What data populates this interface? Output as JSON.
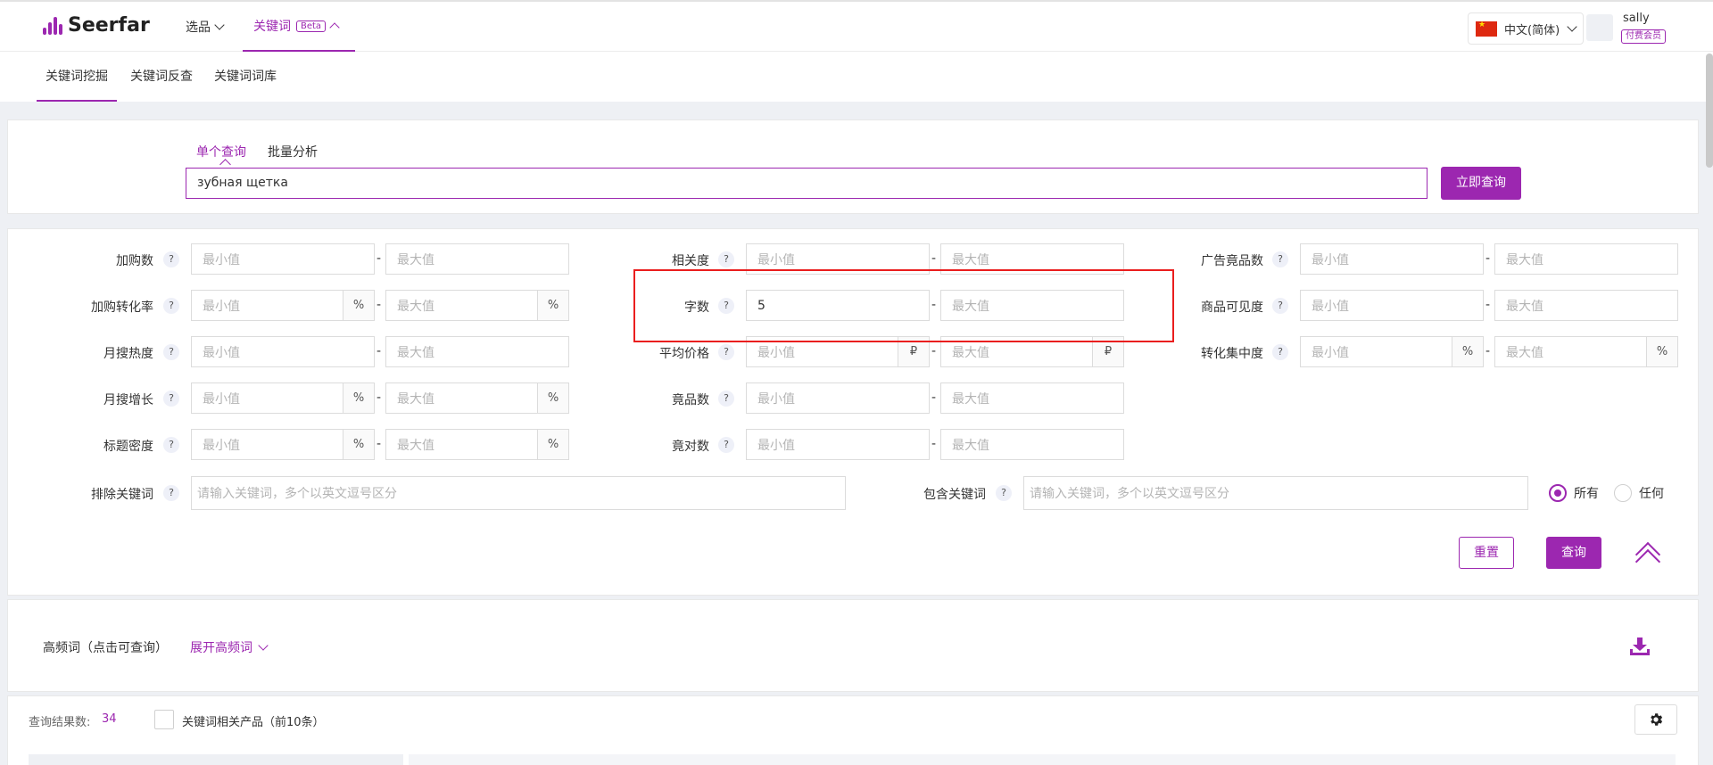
{
  "header": {
    "brand": "Seerfar",
    "nav": [
      {
        "label": "选品"
      },
      {
        "label": "关键词",
        "badge": "Beta"
      }
    ],
    "language": "中文(简体)",
    "user": {
      "name": "sally",
      "badge": "付费会员"
    }
  },
  "subnav": {
    "tabs": [
      "关键词挖掘",
      "关键词反查",
      "关键词词库"
    ],
    "active": 0
  },
  "query": {
    "tabs": [
      "单个查询",
      "批量分析"
    ],
    "active": 0,
    "value": "зубная щетка",
    "submit": "立即查询"
  },
  "filters": {
    "min_ph": "最小值",
    "max_ph": "最大值",
    "help": "?",
    "dash": "-",
    "labels": {
      "add_cart": "加购数",
      "add_cart_rate": "加购转化率",
      "month_heat": "月搜热度",
      "month_growth": "月搜增长",
      "title_density": "标题密度",
      "relevance": "相关度",
      "word_count": "字数",
      "avg_price": "平均价格",
      "products": "竟品数",
      "competitors": "竟对数",
      "ad_products": "广告竟品数",
      "visibility": "商品可见度",
      "conversion": "转化集中度"
    },
    "units": {
      "percent": "%",
      "ruble": "₽"
    },
    "word_count_min": "5",
    "exclude_label": "排除关键词",
    "exclude_ph": "请输入关键词，多个以英文逗号区分",
    "include_label": "包含关键词",
    "include_ph": "请输入关键词，多个以英文逗号区分",
    "match_options": [
      "所有",
      "任何"
    ],
    "match_selected": 0,
    "reset": "重置",
    "search": "查询"
  },
  "high_freq": {
    "label": "高频词（点击可查询）",
    "expand": "展开高频词"
  },
  "results": {
    "count_label": "查询结果数:",
    "count": "34",
    "related_label": "关键词相关产品（前10条）"
  },
  "colors": {
    "accent": "#9c27b0",
    "highlight": "#ea1e1e"
  }
}
